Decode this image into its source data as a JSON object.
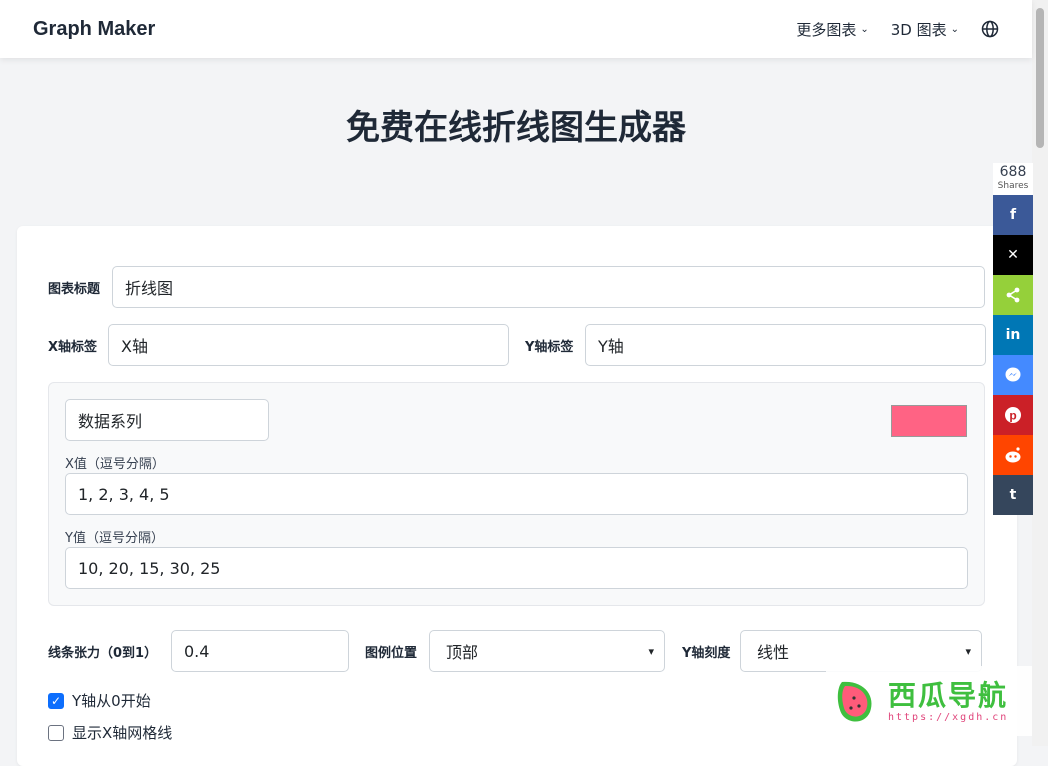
{
  "header": {
    "brand": "Graph Maker",
    "nav": [
      {
        "label": "更多图表"
      },
      {
        "label": "3D 图表"
      }
    ]
  },
  "page": {
    "title": "免费在线折线图生成器"
  },
  "form": {
    "chart_title_label": "图表标题",
    "chart_title_value": "折线图",
    "x_label_label": "X轴标签",
    "x_label_value": "X轴",
    "y_label_label": "Y轴标签",
    "y_label_value": "Y轴",
    "series": {
      "name_value": "数据系列",
      "color": "#ff6384",
      "x_values_label": "X值（逗号分隔）",
      "x_values_value": "1, 2, 3, 4, 5",
      "y_values_label": "Y值（逗号分隔）",
      "y_values_value": "10, 20, 15, 30, 25"
    },
    "tension_label": "线条张力（0到1）",
    "tension_value": "0.4",
    "legend_label": "图例位置",
    "legend_value": "顶部",
    "yscale_label": "Y轴刻度",
    "yscale_value": "线性",
    "begin_at_zero_label": "Y轴从0开始",
    "begin_at_zero_checked": true,
    "x_grid_label": "显示X轴网格线",
    "x_grid_checked": false
  },
  "share": {
    "count": "688",
    "count_label": "Shares",
    "buttons": [
      {
        "name": "facebook",
        "glyph": "f",
        "color": "#3b5998"
      },
      {
        "name": "x",
        "glyph": "𝕏",
        "color": "#000000"
      },
      {
        "name": "share",
        "glyph": "⋖",
        "color": "#95d03a"
      },
      {
        "name": "linkedin",
        "glyph": "in",
        "color": "#0077b5"
      },
      {
        "name": "messenger",
        "glyph": "✉",
        "color": "#448aff"
      },
      {
        "name": "pinterest",
        "glyph": "P",
        "color": "#cb2027"
      },
      {
        "name": "reddit",
        "glyph": "●",
        "color": "#ff4500"
      },
      {
        "name": "tumblr",
        "glyph": "t",
        "color": "#35465c"
      }
    ]
  },
  "watermark": {
    "text": "西瓜导航",
    "url": "https://xgdh.cn"
  }
}
